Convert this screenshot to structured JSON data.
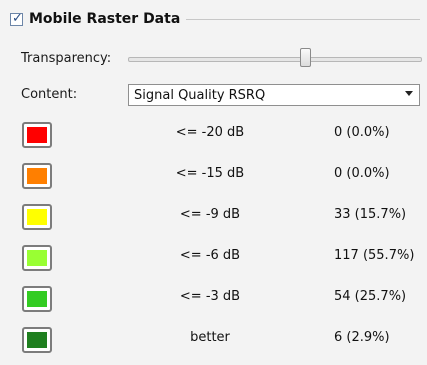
{
  "group": {
    "checked": true,
    "check_glyph": "✓",
    "title": "Mobile Raster Data"
  },
  "transparency": {
    "label": "Transparency:"
  },
  "content": {
    "label": "Content:",
    "value": "Signal Quality RSRQ"
  },
  "legend": [
    {
      "color": "#ff0000",
      "range": "<= -20 dB",
      "count": "0 (0.0%)"
    },
    {
      "color": "#ff7f00",
      "range": "<= -15 dB",
      "count": "0 (0.0%)"
    },
    {
      "color": "#ffff00",
      "range": "<= -9 dB",
      "count": "33 (15.7%)"
    },
    {
      "color": "#99ff33",
      "range": "<= -6 dB",
      "count": "117 (55.7%)"
    },
    {
      "color": "#33cc22",
      "range": "<= -3 dB",
      "count": "54 (25.7%)"
    },
    {
      "color": "#1f7f1f",
      "range": "better",
      "count": "6 (2.9%)"
    }
  ]
}
